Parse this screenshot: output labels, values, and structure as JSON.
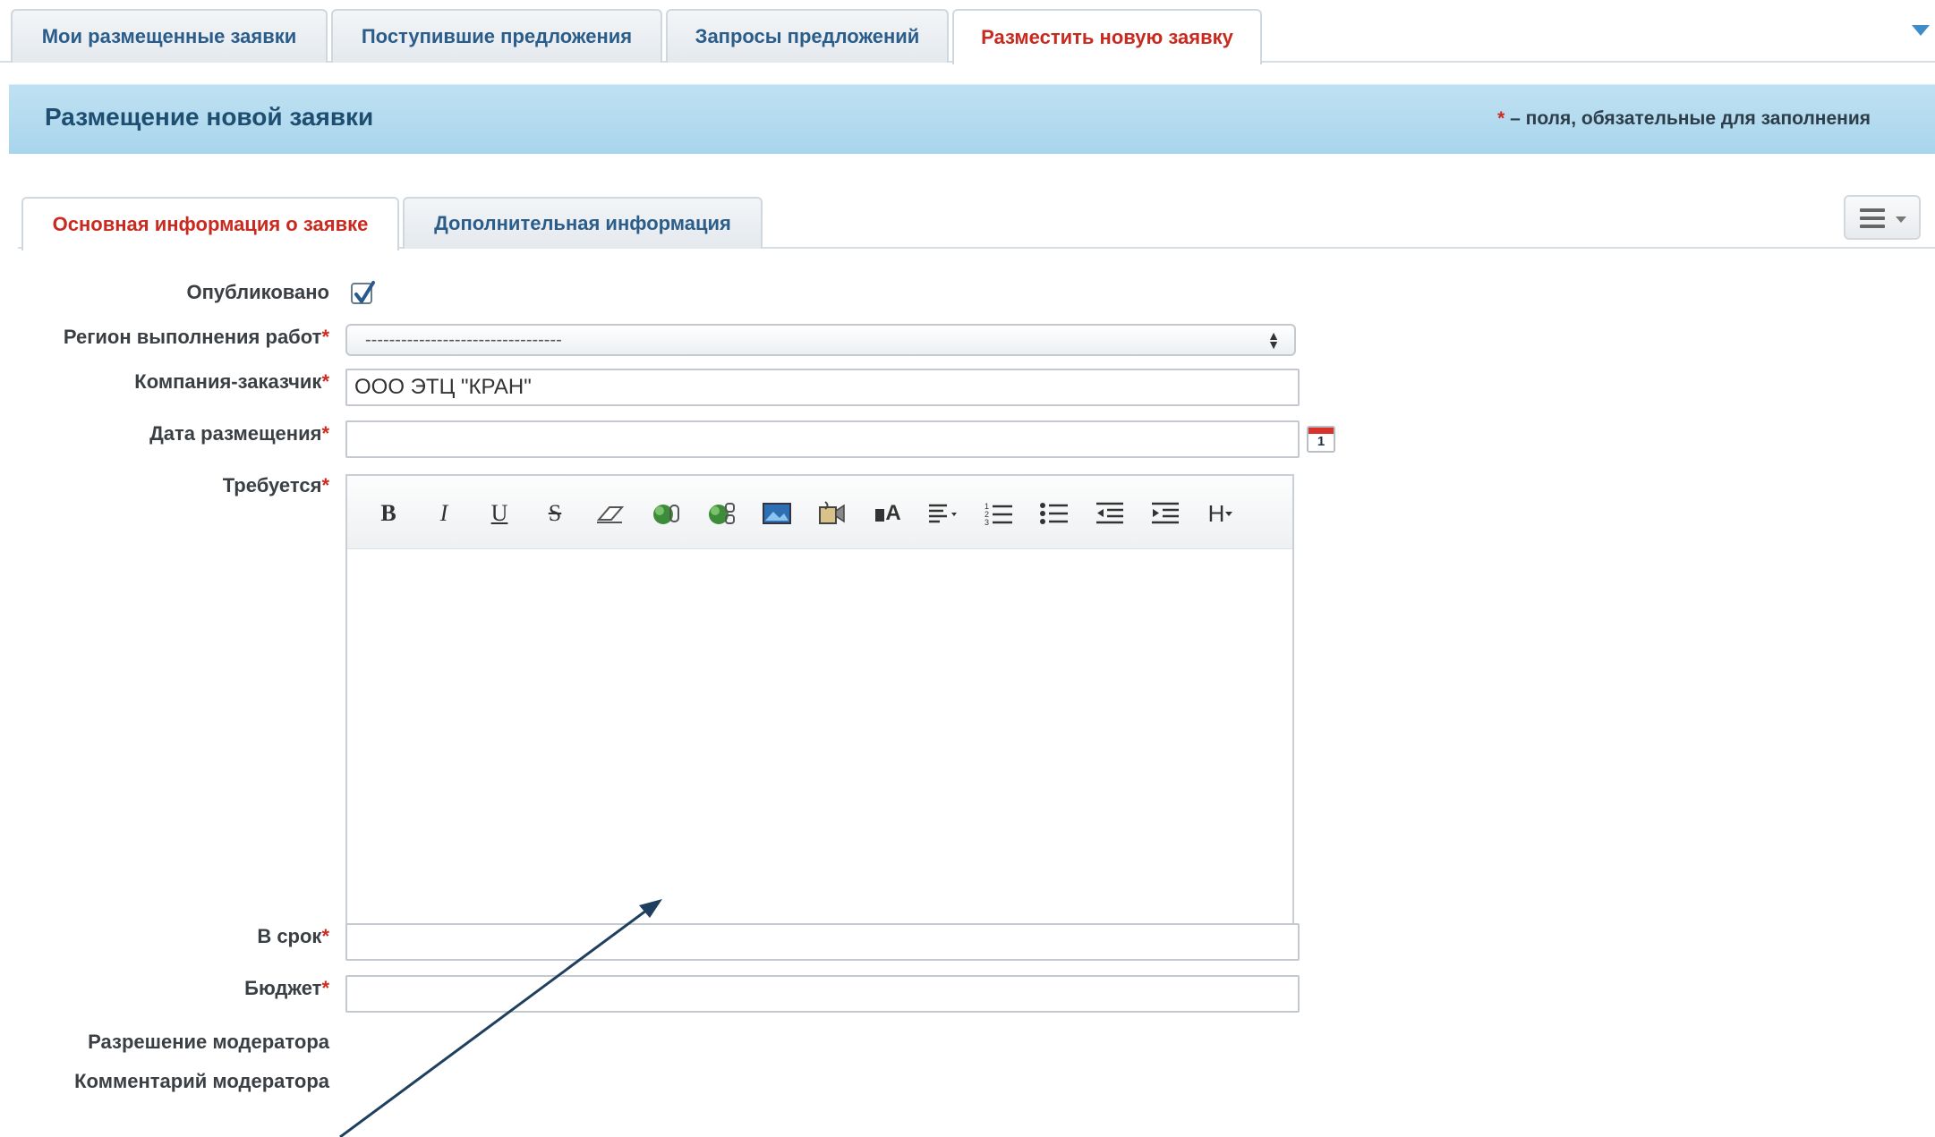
{
  "top_tabs": [
    {
      "label": "Мои размещенные заявки"
    },
    {
      "label": "Поступившие предложения"
    },
    {
      "label": "Запросы предложений"
    },
    {
      "label": "Разместить новую заявку",
      "active": true
    }
  ],
  "header": {
    "title": "Размещение новой заявки",
    "required_star": "*",
    "required_note": " – поля, обязательные для заполнения"
  },
  "inner_tabs": [
    {
      "label": "Основная информация о заявке",
      "active": true
    },
    {
      "label": "Дополнительная информация"
    }
  ],
  "form": {
    "published": {
      "label": "Опубликовано",
      "checked": true
    },
    "region": {
      "label": "Регион выполнения работ",
      "star": "*",
      "value": "---------------------------------"
    },
    "company": {
      "label": "Компания-заказчик",
      "star": "*",
      "value": "ООО ЭТЦ \"КРАН\""
    },
    "date": {
      "label": "Дата размещения",
      "star": "*",
      "value": "",
      "calendar_day": "1"
    },
    "required": {
      "label": "Требуется",
      "star": "*"
    },
    "deadline": {
      "label": "В срок",
      "star": "*",
      "value": ""
    },
    "budget": {
      "label": "Бюджет",
      "star": "*",
      "value": ""
    },
    "moderator_permission": {
      "label": "Разрешение модератора"
    },
    "moderator_comment": {
      "label": "Комментарий модератора"
    }
  },
  "editor_toolbar": [
    {
      "name": "bold-icon",
      "glyph": "B"
    },
    {
      "name": "italic-icon",
      "glyph": "I"
    },
    {
      "name": "underline-icon",
      "glyph": "U"
    },
    {
      "name": "strikethrough-icon",
      "glyph": "S"
    },
    {
      "name": "eraser-icon",
      "glyph": ""
    },
    {
      "name": "insert-link-icon",
      "glyph": ""
    },
    {
      "name": "remove-link-icon",
      "glyph": ""
    },
    {
      "name": "insert-image-icon",
      "glyph": ""
    },
    {
      "name": "insert-video-icon",
      "glyph": ""
    },
    {
      "name": "font-size-icon",
      "glyph": "A"
    },
    {
      "name": "align-dropdown-icon",
      "glyph": "≡"
    },
    {
      "name": "ordered-list-icon",
      "glyph": ""
    },
    {
      "name": "unordered-list-icon",
      "glyph": ""
    },
    {
      "name": "outdent-icon",
      "glyph": ""
    },
    {
      "name": "indent-icon",
      "glyph": ""
    },
    {
      "name": "heading-dropdown-icon",
      "glyph": "H"
    }
  ],
  "colors": {
    "accent_red": "#c92a1f",
    "tab_blue": "#2b5d8a",
    "header_band": "#b5dbef",
    "arrow": "#1f3f5e"
  }
}
